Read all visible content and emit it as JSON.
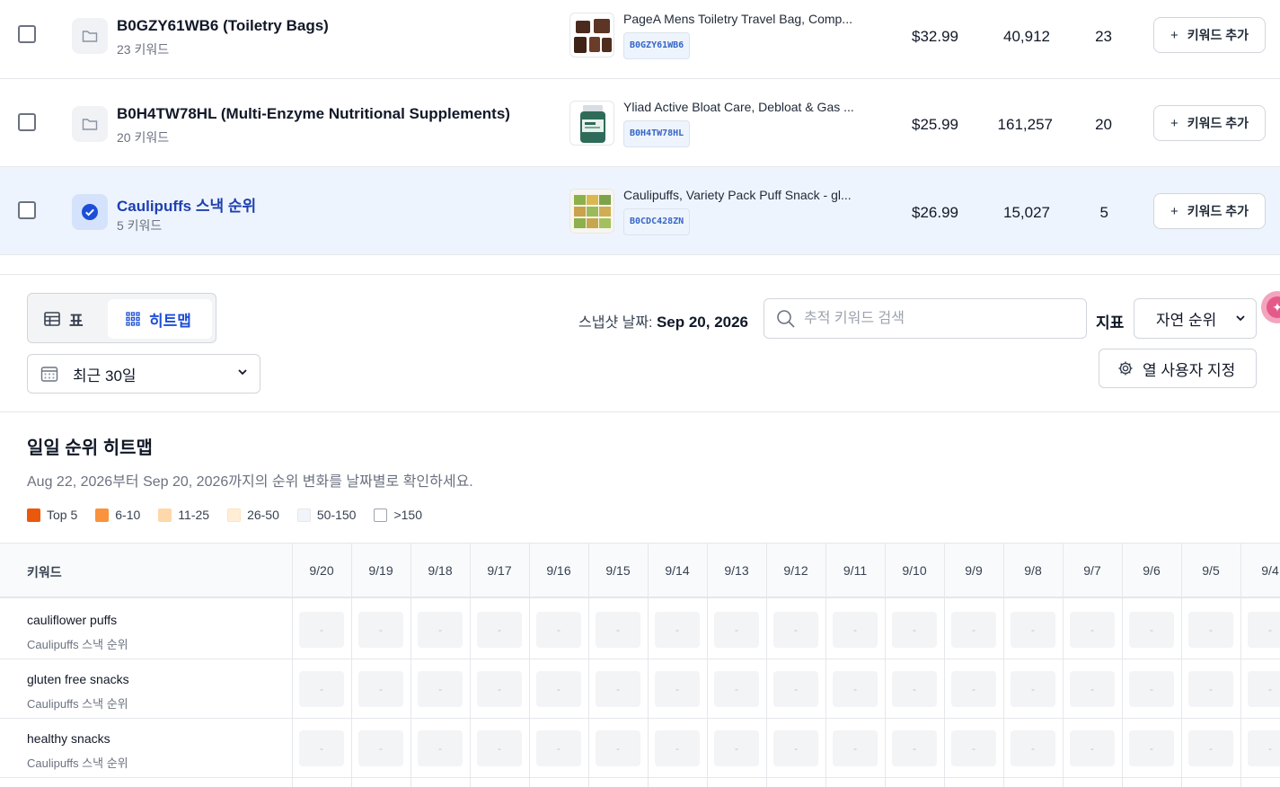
{
  "groups": [
    {
      "name": "B0GZY61WB6 (Toiletry Bags)",
      "keywords_label": "23 키워드",
      "product_title": "PageA Mens Toiletry Travel Bag, Comp...",
      "asin": "B0GZY61WB6",
      "price": "$32.99",
      "reviews": "40,912",
      "keyword_count": "23",
      "add_label": "키워드 추가",
      "selected": false,
      "image": "toiletry-bag-image"
    },
    {
      "name": "B0H4TW78HL (Multi-Enzyme Nutritional Supplements)",
      "keywords_label": "20 키워드",
      "product_title": "Yliad Active Bloat Care, Debloat & Gas ...",
      "asin": "B0H4TW78HL",
      "price": "$25.99",
      "reviews": "161,257",
      "keyword_count": "20",
      "add_label": "키워드 추가",
      "selected": false,
      "image": "supplement-bottle-image"
    },
    {
      "name": "Caulipuffs 스낵 순위",
      "keywords_label": "5 키워드",
      "product_title": "Caulipuffs, Variety Pack Puff Snack - gl...",
      "asin": "B0CDC428ZN",
      "price": "$26.99",
      "reviews": "15,027",
      "keyword_count": "5",
      "add_label": "키워드 추가",
      "selected": true,
      "image": "snack-pack-image"
    }
  ],
  "view_toggle": {
    "table_label": "표",
    "heatmap_label": "히트맵",
    "active": "heatmap"
  },
  "date_range": {
    "value": "최근 30일"
  },
  "snapshot": {
    "label": "스냅샷 날짜: ",
    "date": "Sep 20, 2026"
  },
  "search": {
    "placeholder": "추적 키워드 검색",
    "value": ""
  },
  "metric": {
    "label": "지표",
    "value": "자연 순위"
  },
  "customize": {
    "label": "열 사용자 지정"
  },
  "heatmap": {
    "title": "일일 순위 히트맵",
    "subtitle": "Aug 22, 2026부터 Sep 20, 2026까지의 순위 변화를 날짜별로 확인하세요.",
    "legend": [
      {
        "label": "Top 5",
        "color": "#ea580c"
      },
      {
        "label": "6-10",
        "color": "#fb923c"
      },
      {
        "label": "11-25",
        "color": "#fed7aa"
      },
      {
        "label": "26-50",
        "color": "#ffedd5"
      },
      {
        "label": "50-150",
        "color": "#f1f5f9"
      },
      {
        "label": ">150",
        "color": "#ffffff"
      }
    ],
    "keyword_header": "키워드",
    "dates": [
      "9/20",
      "9/19",
      "9/18",
      "9/17",
      "9/16",
      "9/15",
      "9/14",
      "9/13",
      "9/12",
      "9/11",
      "9/10",
      "9/9",
      "9/8",
      "9/7",
      "9/6",
      "9/5",
      "9/4"
    ],
    "rows": [
      {
        "keyword": "cauliflower puffs",
        "group": "Caulipuffs 스낵 순위",
        "cells": [
          "-",
          "-",
          "-",
          "-",
          "-",
          "-",
          "-",
          "-",
          "-",
          "-",
          "-",
          "-",
          "-",
          "-",
          "-",
          "-",
          "-"
        ]
      },
      {
        "keyword": "gluten free snacks",
        "group": "Caulipuffs 스낵 순위",
        "cells": [
          "-",
          "-",
          "-",
          "-",
          "-",
          "-",
          "-",
          "-",
          "-",
          "-",
          "-",
          "-",
          "-",
          "-",
          "-",
          "-",
          "-"
        ]
      },
      {
        "keyword": "healthy snacks",
        "group": "Caulipuffs 스낵 순위",
        "cells": [
          "-",
          "-",
          "-",
          "-",
          "-",
          "-",
          "-",
          "-",
          "-",
          "-",
          "-",
          "-",
          "-",
          "-",
          "-",
          "-",
          "-"
        ]
      }
    ]
  }
}
